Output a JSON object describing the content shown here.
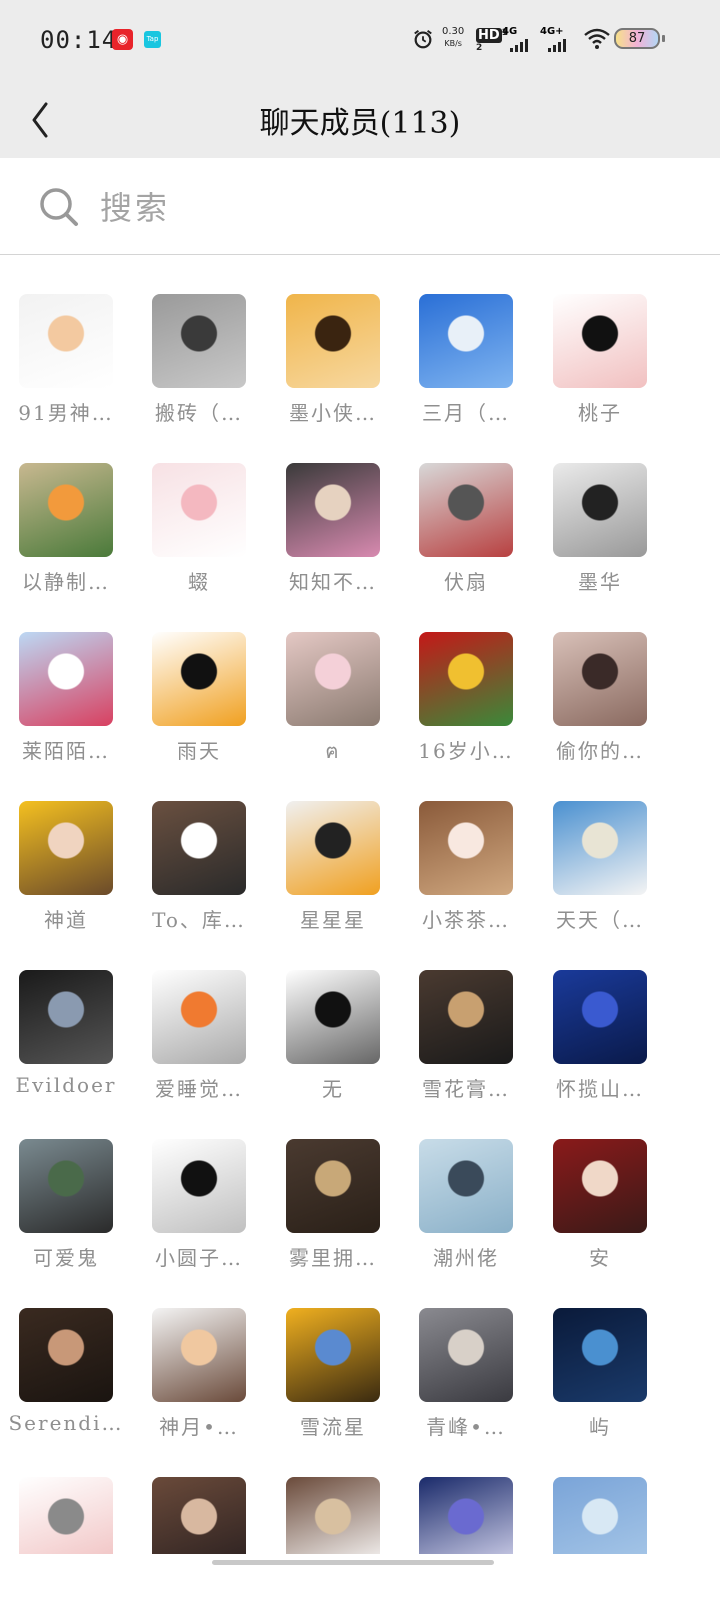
{
  "status_bar": {
    "time": "00:14",
    "net_speed_value": "0.30",
    "net_speed_unit": "KB/s",
    "hd_label": "HD",
    "sim1_label": "4G",
    "sim2_label": "4G+",
    "battery": "87",
    "icons": [
      "netease-music-app-icon",
      "tap-app-icon",
      "alarm-icon",
      "hd-icon",
      "signal-icon",
      "signal-icon",
      "wifi-icon",
      "battery-icon"
    ]
  },
  "header": {
    "back_icon": "chevron-left-icon",
    "title": "聊天成员(113)"
  },
  "search": {
    "placeholder": "搜索",
    "value": "",
    "icon": "search-icon"
  },
  "members": [
    {
      "name": "91男神…",
      "avatar": "panda-cartoon",
      "colors": [
        "#f2f2f2",
        "#f3c9a0",
        "#ffffff"
      ]
    },
    {
      "name": "搬砖（…",
      "avatar": "grayscale-portrait",
      "colors": [
        "#9a9a9a",
        "#3a3a3a",
        "#c8c8c8"
      ]
    },
    {
      "name": "墨小侠…",
      "avatar": "couple-silhouette",
      "colors": [
        "#f0b54a",
        "#3a2410",
        "#f7d8a0"
      ]
    },
    {
      "name": "三月（…",
      "avatar": "white-bunny-toy",
      "colors": [
        "#2a6fd6",
        "#e8f0f8",
        "#7fb4f0"
      ]
    },
    {
      "name": "桃子",
      "avatar": "anime-girl",
      "colors": [
        "#ffffff",
        "#111111",
        "#f1c0c0"
      ]
    },
    {
      "name": "以静制…",
      "avatar": "tiger-cartoon",
      "colors": [
        "#c8b890",
        "#f29a3c",
        "#4a7a3a"
      ]
    },
    {
      "name": "蝃",
      "avatar": "pink-pig-cartoon",
      "colors": [
        "#f7e1e4",
        "#f4b8c0",
        "#ffffff"
      ]
    },
    {
      "name": "知知不…",
      "avatar": "dog-in-flowers",
      "colors": [
        "#3a3a3a",
        "#e6d2c0",
        "#d88ab0"
      ]
    },
    {
      "name": "伏扇",
      "avatar": "anime-white-hair",
      "colors": [
        "#d8d8d8",
        "#555555",
        "#b84040"
      ]
    },
    {
      "name": "墨华",
      "avatar": "anime-boys",
      "colors": [
        "#eaeaea",
        "#222222",
        "#999999"
      ]
    },
    {
      "name": "莱陌陌…",
      "avatar": "hot-air-balloon",
      "colors": [
        "#bcd8f4",
        "#ffffff",
        "#d84060"
      ]
    },
    {
      "name": "雨天",
      "avatar": "cartoon-sunglasses",
      "colors": [
        "#ffffff",
        "#111111",
        "#f0a020"
      ]
    },
    {
      "name": "ฅ",
      "avatar": "cat-in-blanket",
      "colors": [
        "#e4c8c4",
        "#f4d0d8",
        "#8a7a70"
      ]
    },
    {
      "name": "16岁小…",
      "avatar": "golden-lion",
      "colors": [
        "#c41818",
        "#f0c030",
        "#3a8a3a"
      ]
    },
    {
      "name": "偷你的…",
      "avatar": "anime-man",
      "colors": [
        "#d8c0b8",
        "#3a2a28",
        "#8a6a60"
      ]
    },
    {
      "name": "神道",
      "avatar": "child-yellow-hood",
      "colors": [
        "#f4c020",
        "#f0d4c0",
        "#6a4a2a"
      ]
    },
    {
      "name": "To、库…",
      "avatar": "mirror-selfie",
      "colors": [
        "#6a5040",
        "#ffffff",
        "#2a2a2a"
      ]
    },
    {
      "name": "星星星",
      "avatar": "dog-penguin-hat",
      "colors": [
        "#f0f0f0",
        "#222222",
        "#f0a020"
      ]
    },
    {
      "name": "小茶茶…",
      "avatar": "anime-brown-hair",
      "colors": [
        "#8a5a3a",
        "#f8e8e0",
        "#d0a880"
      ]
    },
    {
      "name": "天天（…",
      "avatar": "doraemon",
      "colors": [
        "#4a90d0",
        "#e8e4d4",
        "#f4f4f4"
      ]
    },
    {
      "name": "Evildoer",
      "avatar": "earth-men",
      "colors": [
        "#1a1a1a",
        "#8a9ab0",
        "#555555"
      ]
    },
    {
      "name": "爱睡觉…",
      "avatar": "chainsaw-dog",
      "colors": [
        "#ffffff",
        "#f07a30",
        "#aaaaaa"
      ]
    },
    {
      "name": "无",
      "avatar": "anime-black-hair",
      "colors": [
        "#ffffff",
        "#111111",
        "#666666"
      ]
    },
    {
      "name": "雪花膏…",
      "avatar": "young-man-photo",
      "colors": [
        "#4a3a30",
        "#c8a070",
        "#1a1a1a"
      ]
    },
    {
      "name": "怀揽山…",
      "avatar": "bird-blue-sky",
      "colors": [
        "#1a3a9a",
        "#3a5ad0",
        "#0a1a4a"
      ]
    },
    {
      "name": "可爱鬼",
      "avatar": "street-photo",
      "colors": [
        "#7a8a90",
        "#4a6a4a",
        "#2a2a2a"
      ]
    },
    {
      "name": "小圆子…",
      "avatar": "sketch-girl",
      "colors": [
        "#ffffff",
        "#111111",
        "#c0c0c0"
      ]
    },
    {
      "name": "雾里拥…",
      "avatar": "monkey-guitar",
      "colors": [
        "#4a3a30",
        "#c8a878",
        "#2a2018"
      ]
    },
    {
      "name": "潮州佬",
      "avatar": "tiger-sky",
      "colors": [
        "#c8dce8",
        "#3a4a5a",
        "#8ab0c8"
      ]
    },
    {
      "name": "安",
      "avatar": "anime-red-hair",
      "colors": [
        "#8a1a1a",
        "#f0d8c8",
        "#3a1a18"
      ]
    },
    {
      "name": "Serendi…",
      "avatar": "man-portrait",
      "colors": [
        "#3a2a20",
        "#c89878",
        "#1a1410"
      ]
    },
    {
      "name": "神月•…",
      "avatar": "angry-cat",
      "colors": [
        "#f4f4f4",
        "#f0c8a0",
        "#6a4a3a"
      ]
    },
    {
      "name": "雪流星",
      "avatar": "golden-trees",
      "colors": [
        "#f0b020",
        "#5a8ad0",
        "#3a2a10"
      ]
    },
    {
      "name": "青峰•…",
      "avatar": "lake-sunset",
      "colors": [
        "#8a8a90",
        "#d8d0c8",
        "#3a3a40"
      ]
    },
    {
      "name": "屿",
      "avatar": "blue-earth",
      "colors": [
        "#0a1a3a",
        "#4a90d0",
        "#1a3a6a"
      ]
    },
    {
      "name": "",
      "avatar": "gray-cat-cartoon",
      "colors": [
        "#ffffff",
        "#8a8a8a",
        "#f0c0c0"
      ]
    },
    {
      "name": "",
      "avatar": "child-photo",
      "colors": [
        "#6a4a3a",
        "#d8b8a0",
        "#2a2020"
      ]
    },
    {
      "name": "",
      "avatar": "latte-art",
      "colors": [
        "#6a4a3a",
        "#d8c0a0",
        "#ffffff"
      ]
    },
    {
      "name": "",
      "avatar": "anime-blue-hair",
      "colors": [
        "#1a2a6a",
        "#6a6ad0",
        "#d8d8f0"
      ]
    },
    {
      "name": "",
      "avatar": "blue-sky-clouds",
      "colors": [
        "#7aa4d8",
        "#d8e8f4",
        "#a8c8e8"
      ]
    }
  ]
}
